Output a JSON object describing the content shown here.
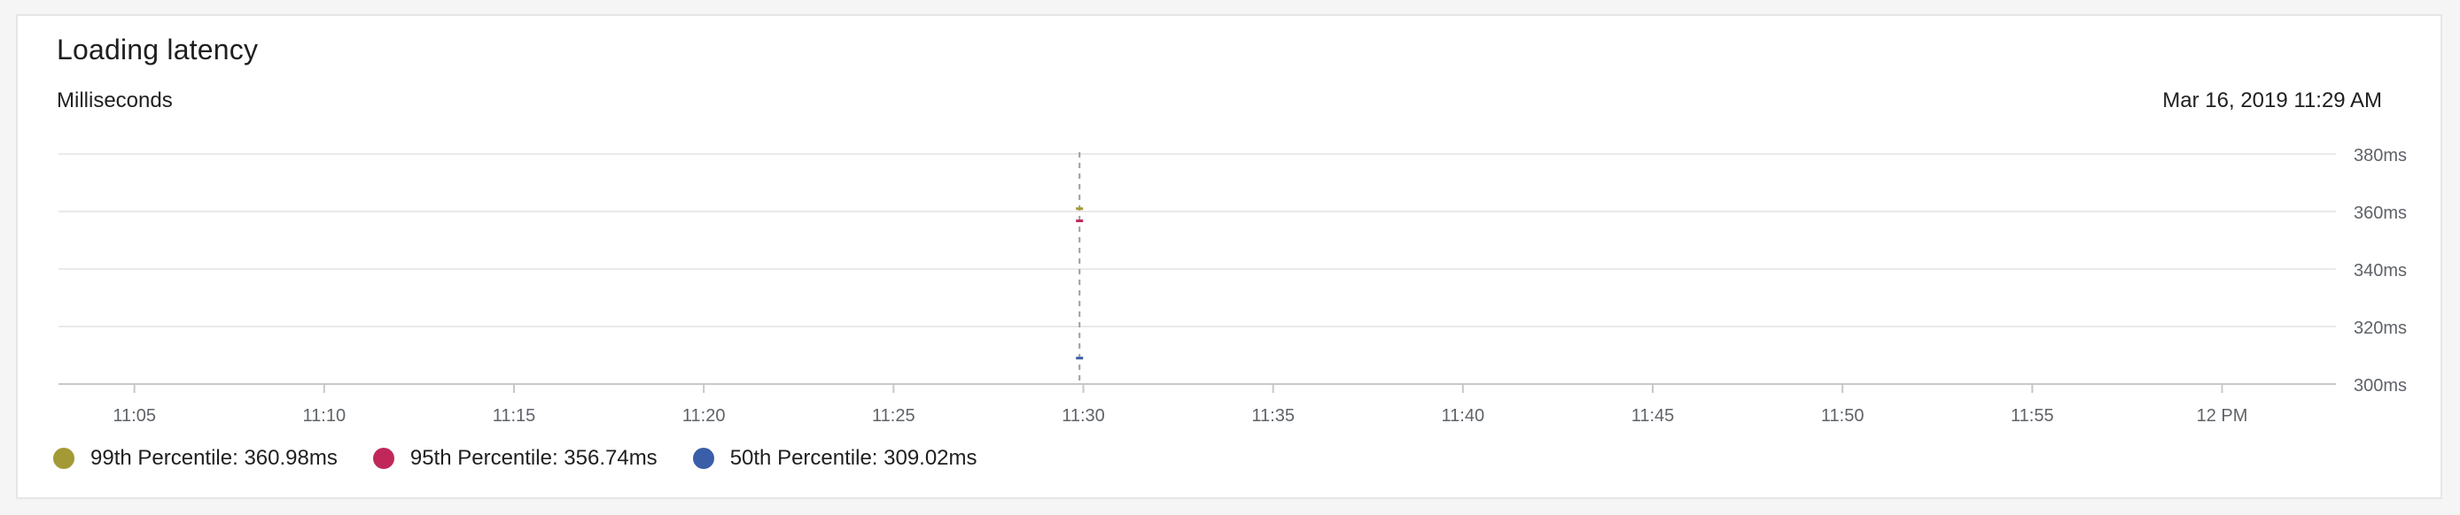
{
  "card": {
    "title": "Loading latency",
    "unit_label": "Milliseconds",
    "timestamp": "Mar 16, 2019 11:29 AM"
  },
  "chart_data": {
    "type": "line",
    "title": "Loading latency",
    "ylabel": "Milliseconds",
    "xlabel": "",
    "x_ticks": [
      "11:05",
      "11:10",
      "11:15",
      "11:20",
      "11:25",
      "11:30",
      "11:35",
      "11:40",
      "11:45",
      "11:50",
      "11:55",
      "12 PM"
    ],
    "x_tick_minutes": [
      5,
      10,
      15,
      20,
      25,
      30,
      35,
      40,
      45,
      50,
      55,
      60
    ],
    "xlim_minutes": [
      3,
      63
    ],
    "y_ticks": [
      "380ms",
      "360ms",
      "340ms",
      "320ms",
      "300ms"
    ],
    "y_tick_values": [
      380,
      360,
      340,
      320,
      300
    ],
    "ylim": [
      300,
      380
    ],
    "grid": true,
    "legend_position": "bottom-left",
    "hover_x": "11:29",
    "hover_x_minutes": 29.9,
    "series": [
      {
        "name": "99th Percentile",
        "x": [
          "11:29"
        ],
        "values": [
          360.98
        ],
        "color": "#a39a35"
      },
      {
        "name": "95th Percentile",
        "x": [
          "11:29"
        ],
        "values": [
          356.74
        ],
        "color": "#c0285a"
      },
      {
        "name": "50th Percentile",
        "x": [
          "11:29"
        ],
        "values": [
          309.02
        ],
        "color": "#3a5ea8"
      }
    ]
  },
  "legend": [
    {
      "label": "99th Percentile: 360.98ms",
      "color": "#a39a35"
    },
    {
      "label": "95th Percentile: 356.74ms",
      "color": "#c0285a"
    },
    {
      "label": "50th Percentile: 309.02ms",
      "color": "#3a5ea8"
    }
  ]
}
